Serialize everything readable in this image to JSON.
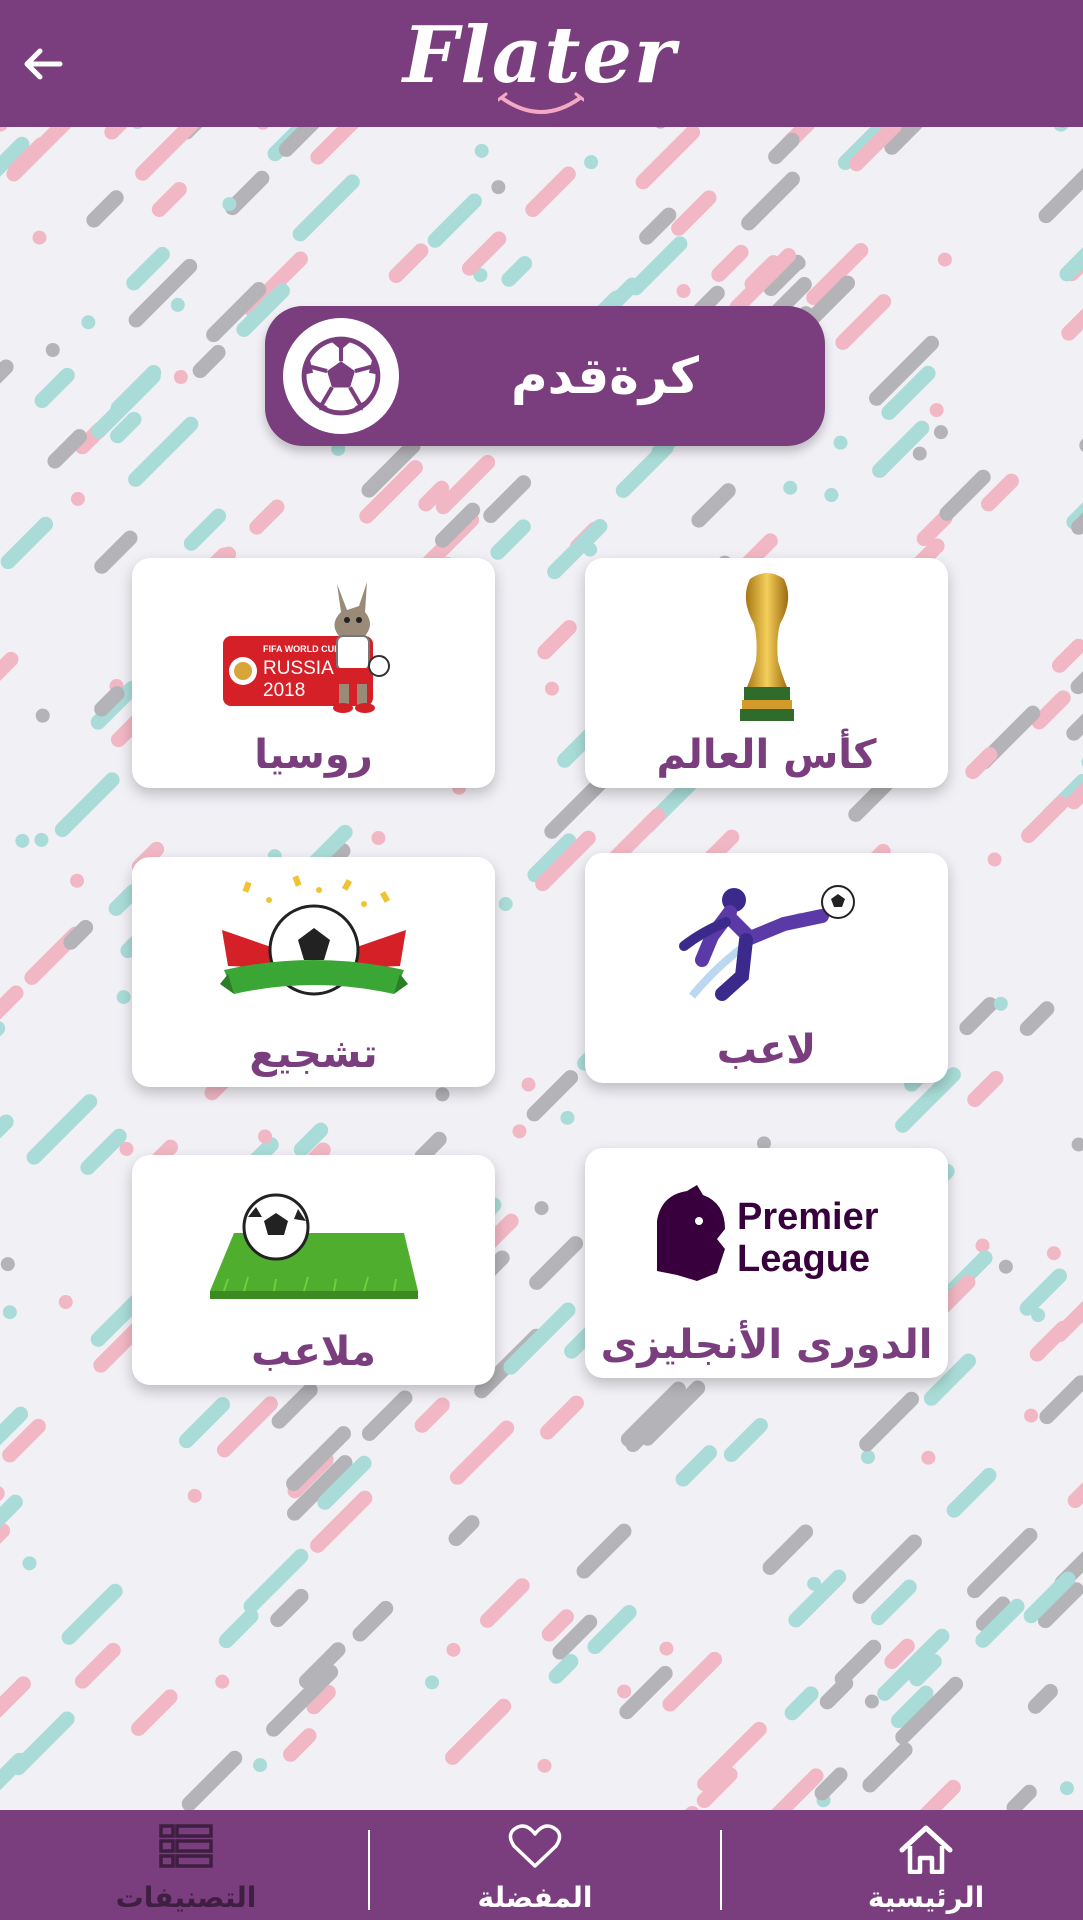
{
  "app": {
    "logo_text": "Flater"
  },
  "colors": {
    "primary": "#7a3d7d",
    "label": "#7a3d7d",
    "background": "#f1f0f5"
  },
  "category": {
    "title": "كرةقدم",
    "icon": "soccer-ball-icon"
  },
  "cards": [
    {
      "label": "كأس العالم",
      "image": "world-cup-trophy"
    },
    {
      "label": "روسيا",
      "image": "fifa-world-cup-russia-2018",
      "image_text": [
        "FIFA WORLD CUP",
        "RUSSIA",
        "2018"
      ]
    },
    {
      "label": "لاعب",
      "image": "player-kicking-ball"
    },
    {
      "label": "تشجيع",
      "image": "cheering-ball-trumpets"
    },
    {
      "label": "الدورى الأنجليزى",
      "image": "premier-league-logo",
      "image_text": [
        "Premier",
        "League"
      ]
    },
    {
      "label": "ملاعب",
      "image": "ball-on-grass"
    }
  ],
  "bottom_nav": {
    "home": {
      "label": "الرئيسية",
      "icon": "home-icon"
    },
    "favorites": {
      "label": "المفضلة",
      "icon": "heart-icon"
    },
    "categories": {
      "label": "التصنيفات",
      "icon": "list-icon"
    }
  }
}
